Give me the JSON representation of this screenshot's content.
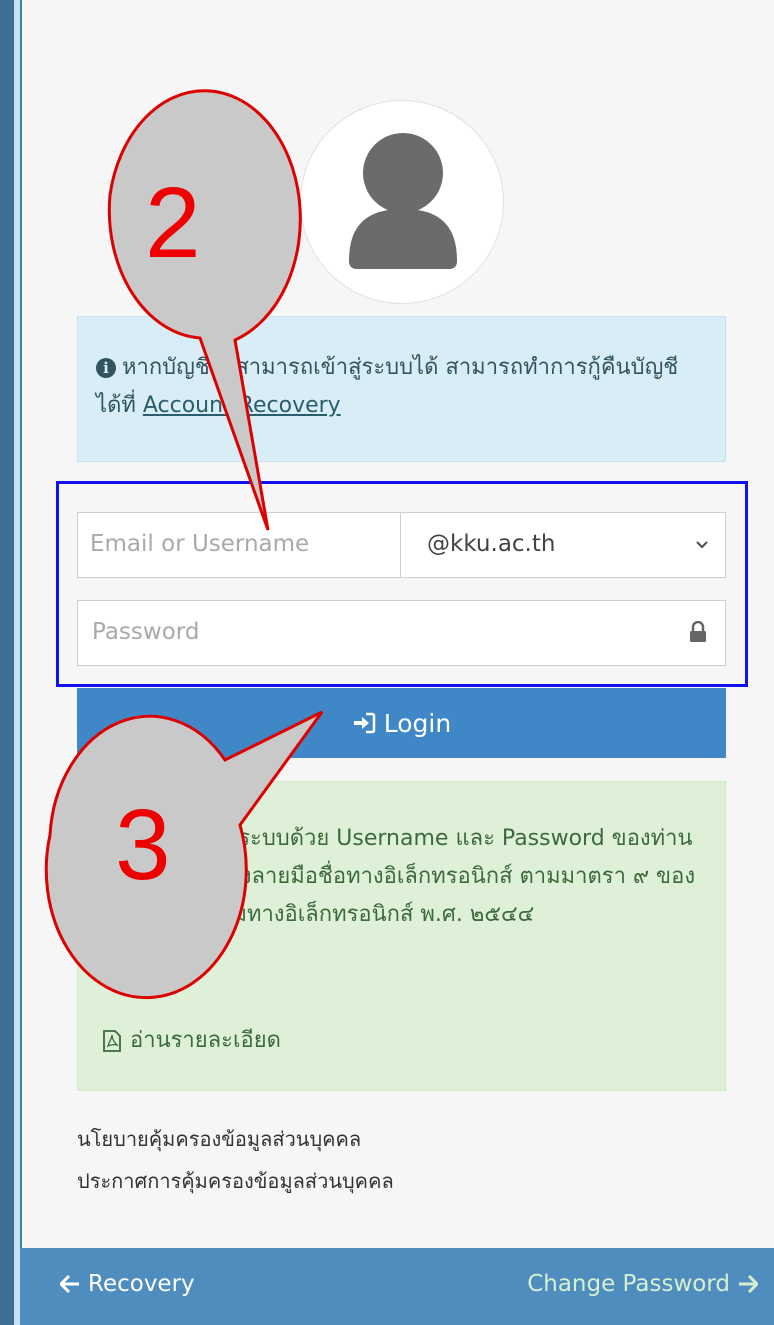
{
  "info": {
    "text": "หากบัญชีไม่สามารถเข้าสู่ระบบได้ สามารถทำการกู้คืนบัญชีได้ที่",
    "link": "Account Recovery"
  },
  "form": {
    "username_placeholder": "Email or Username",
    "domain_selected": "@kku.ac.th",
    "password_placeholder": "Password"
  },
  "login": {
    "label": "Login"
  },
  "notice": {
    "text": "การเข้าใช้งานระบบด้วย Username และ Password ของท่านถือว่าเป็นการลงลายมือชื่อทางอิเล็กทรอนิกส์ ตามมาตรา ๙ ของ พ.ร.บ. ธุรกรรมทางอิเล็กทรอนิกส์ พ.ศ. ๒๕๔๔",
    "read_more": "อ่านรายละเอียด"
  },
  "links": {
    "privacy_policy": "นโยบายคุ้มครองข้อมูลส่วนบุคคล",
    "privacy_notice": "ประกาศการคุ้มครองข้อมูลส่วนบุคคล"
  },
  "footer": {
    "recovery": "Recovery",
    "change_password": "Change Password"
  },
  "callouts": {
    "step2": "2",
    "step3": "3"
  },
  "colors": {
    "primary": "#3f87c7",
    "info_bg": "#d9edf6",
    "success_bg": "#dff0d8",
    "footer_bg": "#4f8dbf",
    "highlight": "#1212ee",
    "callout_red": "#ee0000"
  }
}
